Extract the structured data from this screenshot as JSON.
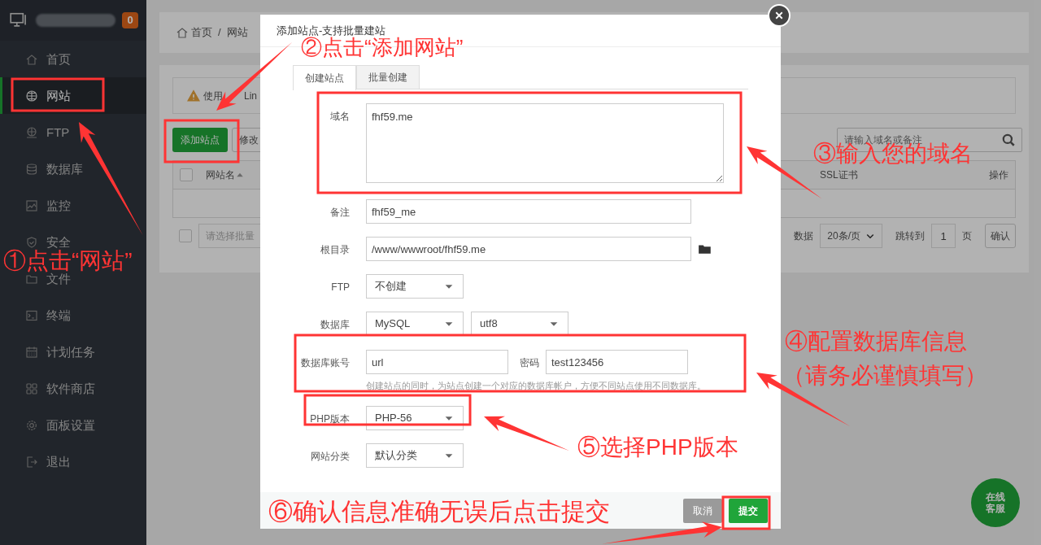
{
  "sidebar": {
    "badge": "0",
    "items": [
      {
        "label": "首页",
        "selected": false
      },
      {
        "label": "网站",
        "selected": true
      },
      {
        "label": "FTP",
        "selected": false
      },
      {
        "label": "数据库",
        "selected": false
      },
      {
        "label": "监控",
        "selected": false
      },
      {
        "label": "安全",
        "selected": false
      },
      {
        "label": "文件",
        "selected": false
      },
      {
        "label": "终端",
        "selected": false
      },
      {
        "label": "计划任务",
        "selected": false
      },
      {
        "label": "软件商店",
        "selected": false
      },
      {
        "label": "面板设置",
        "selected": false
      },
      {
        "label": "退出",
        "selected": false
      }
    ]
  },
  "breadcrumb": {
    "items": [
      "首页",
      "网站"
    ],
    "separator": "/"
  },
  "alert": {
    "segments": [
      "使用",
      "Lin"
    ]
  },
  "toolbar": {
    "buttons": [
      "添加站点",
      "修改"
    ],
    "search": {
      "placeholder": "请输入域名或备注"
    }
  },
  "table": {
    "select_all_checked": false,
    "columns": [
      "网站名",
      "SSL证书",
      "操作"
    ]
  },
  "footer": {
    "checked": false,
    "batch_placeholder": "请选择批量",
    "count_text": "数据",
    "page_size": "20条/页",
    "jump_label": "跳转到",
    "page": "1",
    "page_unit": "页",
    "confirm": "确认"
  },
  "modal": {
    "title": "添加站点-支持批量建站",
    "tabs": [
      {
        "label": "创建站点",
        "selected": true
      },
      {
        "label": "批量创建",
        "selected": false
      }
    ],
    "fields": [
      {
        "kind": "textarea",
        "label": "域名",
        "value": "fhf59.me"
      },
      {
        "kind": "input",
        "label": "备注",
        "value": "fhf59_me"
      },
      {
        "kind": "path",
        "label": "根目录",
        "value": "/www/wwwroot/fhf59.me"
      },
      {
        "kind": "select",
        "label": "FTP",
        "value": "不创建"
      },
      {
        "kind": "select2",
        "label": "数据库",
        "value": "MySQL",
        "value2": "utf8"
      },
      {
        "kind": "account",
        "label": "数据库账号",
        "value": "url",
        "label2": "密码",
        "value2": "test123456",
        "hint": "创建站点的同时，为站点创建一个对应的数据库帐户，方便不同站点使用不同数据库。"
      },
      {
        "kind": "select",
        "label": "PHP版本",
        "value": "PHP-56"
      },
      {
        "kind": "select",
        "label": "网站分类",
        "value": "默认分类"
      }
    ],
    "buttons": [
      {
        "label": "取消",
        "kind": "cancel"
      },
      {
        "label": "提交",
        "kind": "submit"
      }
    ]
  },
  "chat_button": {
    "label": "在线客服"
  },
  "annotations": [
    {
      "text": "①点击“网站”"
    },
    {
      "text": "②点击“添加网站”"
    },
    {
      "text": "③输入您的域名"
    },
    {
      "text": "④配置数据库信息"
    },
    {
      "text": "（请务必谨慎填写）"
    },
    {
      "text": "⑤选择PHP版本"
    },
    {
      "text": "⑥确认信息准确无误后点击提交"
    }
  ]
}
